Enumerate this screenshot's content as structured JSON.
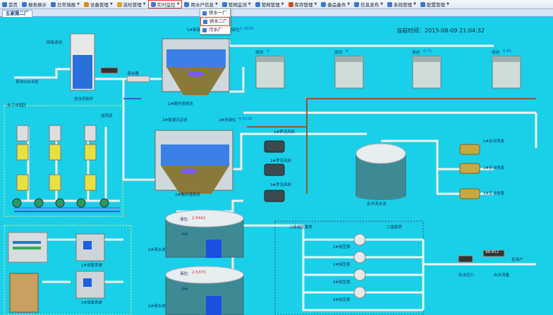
{
  "menu": [
    {
      "label": "首页",
      "color": "#3a78d0"
    },
    {
      "label": "报表展示",
      "color": "#3a78d0"
    },
    {
      "label": "日常填报",
      "color": "#3a78d0"
    },
    {
      "label": "设备管理",
      "color": "#e08a20"
    },
    {
      "label": "巡检管理",
      "color": "#e0a020"
    },
    {
      "label": "实时监控",
      "color": "#3a78d0"
    },
    {
      "label": "用水户信息",
      "color": "#3a78d0"
    },
    {
      "label": "管网监测",
      "color": "#3a78d0"
    },
    {
      "label": "管网管理",
      "color": "#3a78d0"
    },
    {
      "label": "库存管理",
      "color": "#d05020"
    },
    {
      "label": "备品备件",
      "color": "#3a78d0"
    },
    {
      "label": "信息发布",
      "color": "#3a78d0"
    },
    {
      "label": "系统管理",
      "color": "#3a78d0"
    },
    {
      "label": "配置管理",
      "color": "#3a78d0"
    }
  ],
  "tab_label": "五家渠二厂",
  "dropdown": [
    "供水一厂",
    "供水二厂",
    "污水厂"
  ],
  "time": "当前时间：2015-08-09 21:04:32",
  "labels": {
    "intake": "来自500水库",
    "backwash": "回收滤池",
    "inlet_well": "进水控制井",
    "mixer": "混合器",
    "dosing": "去工业园区",
    "dosing_room": "加药间",
    "settle1_top": "1#絮凝沉淀池",
    "settle1_bot": "1#搅拌澄清池",
    "settle1_level": "1#池液位",
    "settle2_top": "2#絮凝沉淀池",
    "settle2_bot": "2#搅拌澄清池",
    "settle2_level": "2#池液位",
    "filter1": "滤池",
    "filter2": "滤池",
    "filter3": "滤池",
    "filter4": "滤池",
    "blower1": "1#罗茨风机",
    "blower2": "2#罗茨风机",
    "blower3": "3#罗茨风机",
    "backwash_pool": "反冲洗水池",
    "bw_pump1": "1#反冲洗泵",
    "bw_pump2": "2#反冲洗泵",
    "bw_pump3": "3#反冲洗泵",
    "tank1": "1#清水池",
    "tank2": "2#清水池",
    "tank1_level": "液位:",
    "tank2_level": "液位:",
    "ph1": "PH:",
    "ph2": "PH:",
    "pump_station": "二级加压泵房",
    "pump_station2": "二级泵房",
    "pump1": "1#加压泵",
    "pump2": "2#加压泵",
    "pump3": "3#加压泵",
    "pump4": "4#加压泵",
    "chlor1": "1#加氯系统",
    "chlor2": "2#加氯系统",
    "outlet_pressure": "出水压力",
    "outlet_flow": "出水流量",
    "user": "至用户"
  },
  "values": {
    "settle1_level": "0.3834",
    "settle2_level": "4.4218",
    "filter1": "0",
    "filter2": "0",
    "filter3": "0.72",
    "filter4": "0.85",
    "tank1_level": "2.5442",
    "tank2_level": "2.5373",
    "flow_reading": "98.812",
    "pressure_reading": "0.386",
    "meter_reading": "8.1263"
  }
}
